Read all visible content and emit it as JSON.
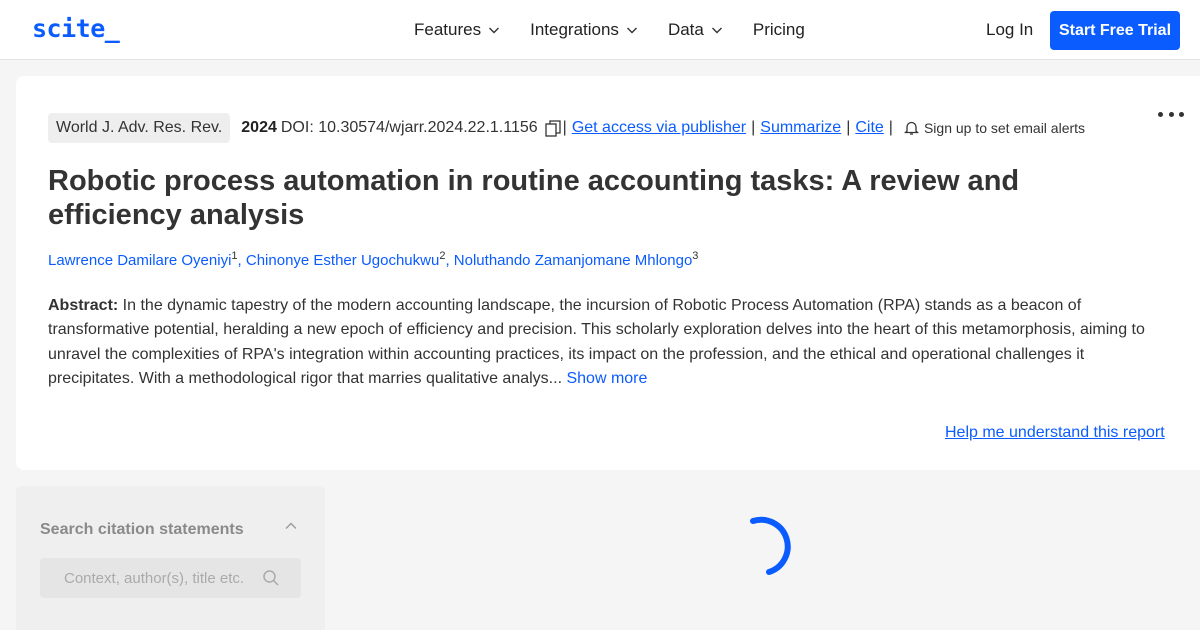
{
  "nav": {
    "logo": "scite_",
    "menu": [
      {
        "label": "Features",
        "has_dropdown": true
      },
      {
        "label": "Integrations",
        "has_dropdown": true
      },
      {
        "label": "Data",
        "has_dropdown": true
      },
      {
        "label": "Pricing",
        "has_dropdown": false
      }
    ],
    "login_label": "Log In",
    "trial_label": "Start Free Trial"
  },
  "article": {
    "journal": "World J. Adv. Res. Rev.",
    "year": "2024",
    "doi": "DOI: 10.30574/wjarr.2024.22.1.1156",
    "links": {
      "publisher": "Get access via publisher",
      "summarize": "Summarize",
      "cite": "Cite"
    },
    "separator": "|",
    "alerts": "Sign up to set email alerts",
    "title": "Robotic process automation in routine accounting tasks: A review and efficiency analysis",
    "authors": [
      {
        "name": "Lawrence Damilare Oyeniyi",
        "sup": "1"
      },
      {
        "name": "Chinonye Esther Ugochukwu",
        "sup": "2"
      },
      {
        "name": "Noluthando Zamanjomane Mhlongo",
        "sup": "3"
      }
    ],
    "author_sep": ", ",
    "abstract_label": "Abstract:",
    "abstract_text": " In the dynamic tapestry of the modern accounting landscape, the incursion of Robotic Process Automation (RPA) stands as a beacon of transformative potential, heralding a new epoch of efficiency and precision. This scholarly exploration delves into the heart of this metamorphosis, aiming to unravel the complexities of RPA's integration within accounting practices, its impact on the profession, and the ethical and operational challenges it precipitates. With a methodological rigor that marries qualitative analys... ",
    "show_more": "Show more",
    "help_link": "Help me understand this report"
  },
  "sidebar": {
    "title": "Search citation statements",
    "search_placeholder": "Context, author(s), title etc."
  },
  "colors": {
    "brand": "#0b5cff",
    "background": "#f5f5f5"
  },
  "icons": {
    "chevron": "chevron-down-icon",
    "copy": "copy-icon",
    "bell": "bell-icon",
    "search": "search-icon",
    "more": "more-horizontal-icon",
    "spinner": "loading-spinner-icon"
  }
}
